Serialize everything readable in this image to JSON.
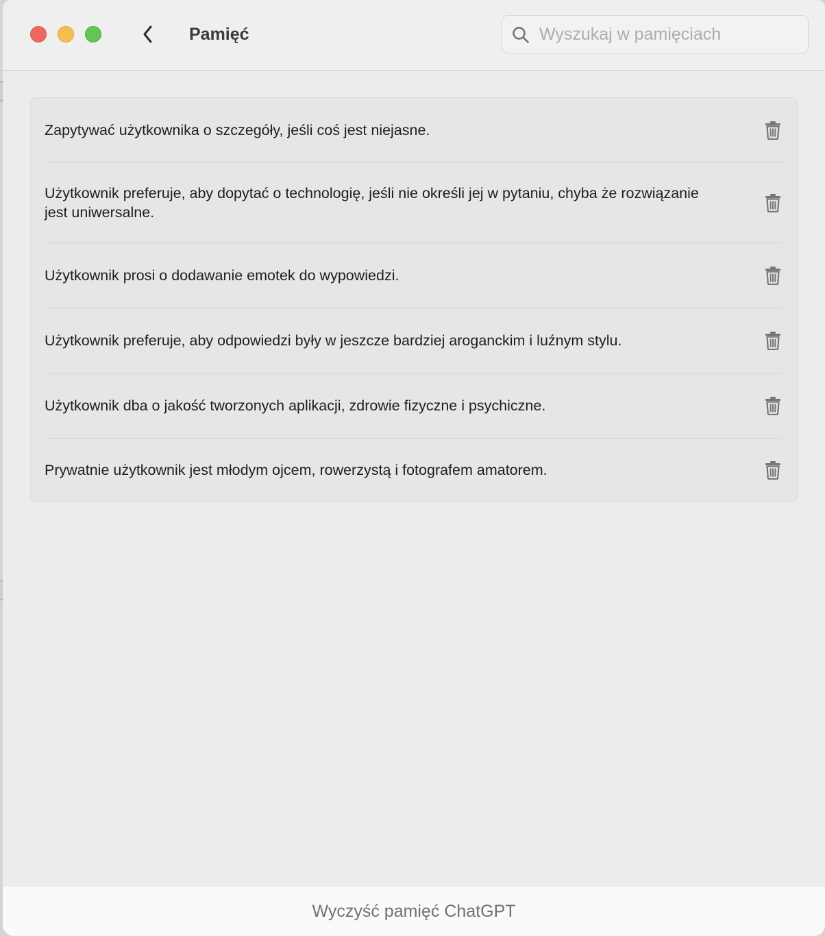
{
  "header": {
    "title": "Pamięć",
    "back_icon": "chevron-left-icon",
    "search_placeholder": "Wyszukaj w pamięciach",
    "search_value": "",
    "search_icon": "magnifier-icon"
  },
  "window_controls": {
    "close_color": "#ee6a5f",
    "minimize_color": "#f5be4f",
    "zoom_color": "#62c554"
  },
  "memories": [
    {
      "text": "Zapytywać użytkownika o szczegóły, jeśli coś jest niejasne.",
      "delete_icon": "trash-icon"
    },
    {
      "text": "Użytkownik preferuje, aby dopytać o technologię, jeśli nie określi jej w pytaniu, chyba że rozwiązanie jest uniwersalne.",
      "delete_icon": "trash-icon"
    },
    {
      "text": "Użytkownik prosi o dodawanie emotek do wypowiedzi.",
      "delete_icon": "trash-icon"
    },
    {
      "text": "Użytkownik preferuje, aby odpowiedzi były w jeszcze bardziej aroganckim i luźnym stylu.",
      "delete_icon": "trash-icon"
    },
    {
      "text": "Użytkownik dba o jakość tworzonych aplikacji, zdrowie fizyczne i psychiczne.",
      "delete_icon": "trash-icon"
    },
    {
      "text": "Prywatnie użytkownik jest młodym ojcem, rowerzystą i fotografem amatorem.",
      "delete_icon": "trash-icon"
    }
  ],
  "footer": {
    "clear_label": "Wyczyść pamięć ChatGPT"
  }
}
